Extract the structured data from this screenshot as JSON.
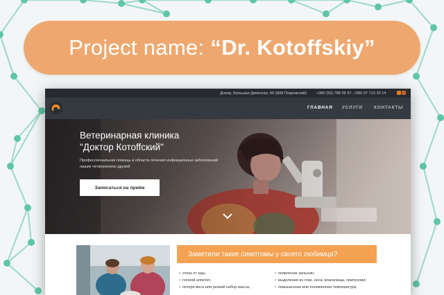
{
  "banner": {
    "label": "Project name:",
    "project_name": "“Dr. Kotoffskiy”"
  },
  "site": {
    "topbar": {
      "address": "Днепр, Большая Диевская, 46 (ЖМ Покровский)",
      "phones": "+380 (56) 788 96 97, +380 97 713 30 14",
      "social": [
        "facebook-icon",
        "instagram-icon"
      ]
    },
    "nav": {
      "items": [
        {
          "label": "ГЛАВНАЯ",
          "active": true
        },
        {
          "label": "УСЛУГИ",
          "active": false
        },
        {
          "label": "КОНТАКТЫ",
          "active": false
        }
      ]
    },
    "hero": {
      "title_line1": "Ветеринарная клиника",
      "title_line2": "\"Доктор Котоffский\"",
      "subtitle": "Профессиональная помощь в области лечения инфекционных заболеваний наших четвероногих друзей",
      "cta_label": "Записаться на приём",
      "scroll_icon": "chevron-down-icon"
    },
    "symptoms": {
      "title": "Заметили такие симптомы у своего любимца?",
      "left": [
        "отказ от еды,",
        "плохой аппетит,",
        "потеря веса или резкий набор массы,"
      ],
      "right": [
        "появление залысин;",
        "выделения из глаз, носа, влагалища, припухлии;",
        "повышенная или пониженная температура;"
      ]
    },
    "colors": {
      "accent": "#f4a252",
      "banner": "#eea86f",
      "dark": "#353a40",
      "network": "#5ec6a6"
    }
  }
}
